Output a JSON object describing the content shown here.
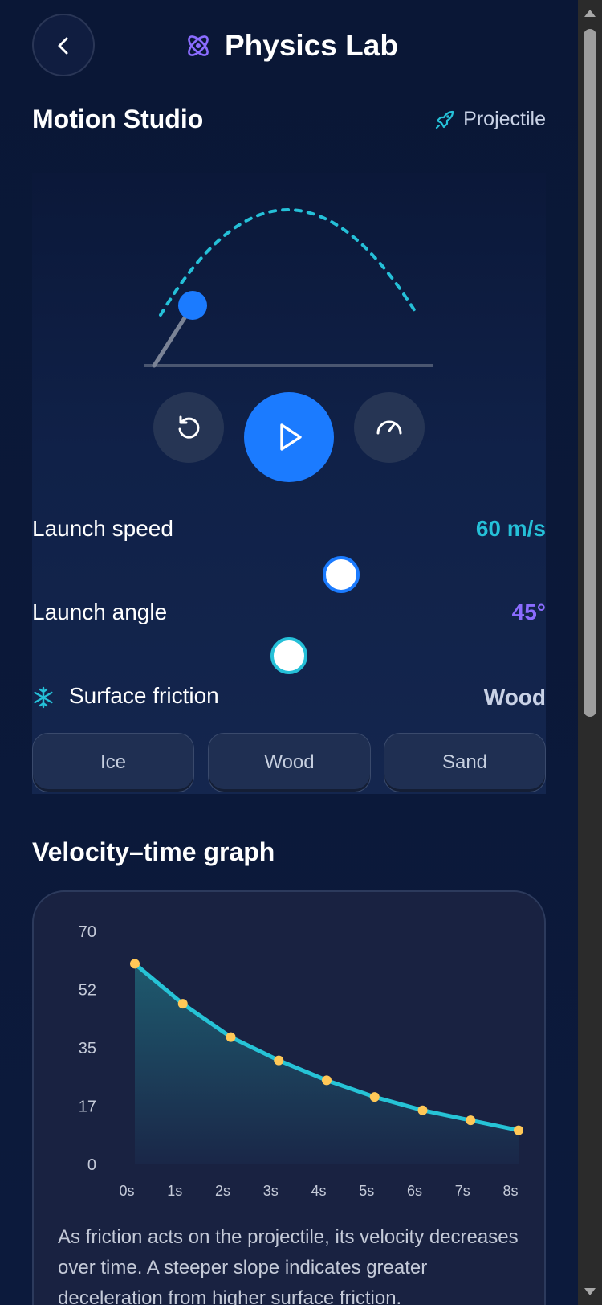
{
  "header": {
    "title": "Physics Lab",
    "back_icon": "chevron-left-icon",
    "logo_icon": "atom-icon"
  },
  "studio": {
    "title": "Motion Studio",
    "mode_label": "Projectile",
    "mode_icon": "rocket-icon",
    "controls": {
      "reset_icon": "rotate-ccw-icon",
      "play_icon": "play-icon",
      "speed_icon": "gauge-icon"
    },
    "launch_speed": {
      "label": "Launch speed",
      "value": "60 m/s",
      "color": "#25c0d8"
    },
    "launch_angle": {
      "label": "Launch angle",
      "value": "45°",
      "color": "#8b6cff"
    },
    "friction": {
      "label": "Surface friction",
      "icon": "snowflake-icon",
      "value": "Wood",
      "options": [
        "Ice",
        "Wood",
        "Sand"
      ]
    }
  },
  "graph": {
    "title": "Velocity–time graph",
    "caption": "As friction acts on the projectile, its velocity decreases over time. A steeper slope indicates greater deceleration from higher surface friction."
  },
  "chart_data": {
    "type": "area",
    "x": [
      "0s",
      "1s",
      "2s",
      "3s",
      "4s",
      "5s",
      "6s",
      "7s",
      "8s"
    ],
    "values": [
      60,
      48,
      38,
      31,
      25,
      20,
      16,
      13,
      10
    ],
    "yticks": [
      "70",
      "52",
      "35",
      "17",
      "0"
    ],
    "ylim": [
      0,
      70
    ],
    "line_color": "#26c3d6",
    "point_color": "#ffc857"
  },
  "colors": {
    "accent_blue": "#1b7bff",
    "accent_cyan": "#25c0d8",
    "accent_purple": "#8b6cff"
  }
}
